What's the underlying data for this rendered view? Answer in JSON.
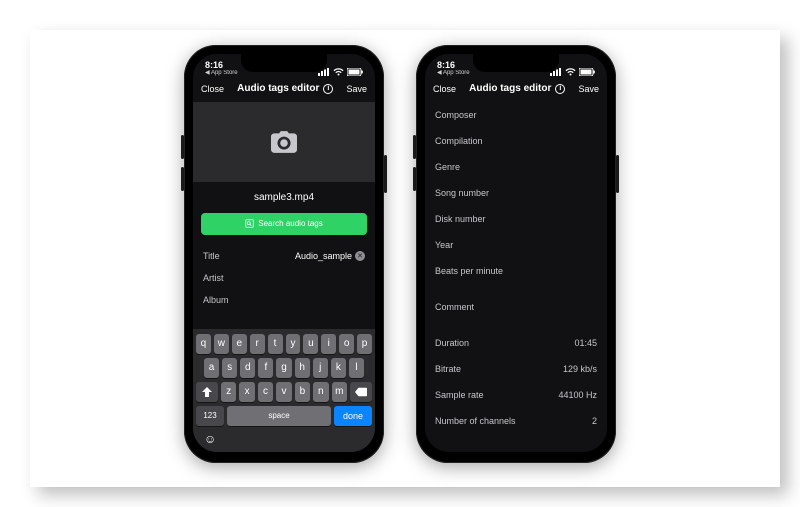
{
  "status": {
    "time": "8:16",
    "back": "◀ App Store"
  },
  "nav": {
    "close": "Close",
    "title": "Audio tags editor",
    "save": "Save"
  },
  "phone1": {
    "filename": "sample3.mp4",
    "search_btn": "Search audio tags",
    "fields": {
      "title_label": "Title",
      "title_value": "Audio_sample",
      "artist_label": "Artist",
      "album_label": "Album"
    },
    "keyboard": {
      "row1": [
        "q",
        "w",
        "e",
        "r",
        "t",
        "y",
        "u",
        "i",
        "o",
        "p"
      ],
      "row2": [
        "a",
        "s",
        "d",
        "f",
        "g",
        "h",
        "j",
        "k",
        "l"
      ],
      "row3": [
        "z",
        "x",
        "c",
        "v",
        "b",
        "n",
        "m"
      ],
      "num": "123",
      "space": "space",
      "done": "done"
    }
  },
  "phone2": {
    "fields": [
      {
        "label": "Composer",
        "value": ""
      },
      {
        "label": "Compilation",
        "value": ""
      },
      {
        "label": "Genre",
        "value": ""
      },
      {
        "label": "Song number",
        "value": ""
      },
      {
        "label": "Disk number",
        "value": ""
      },
      {
        "label": "Year",
        "value": ""
      },
      {
        "label": "Beats per minute",
        "value": ""
      }
    ],
    "comment_label": "Comment",
    "readonly": [
      {
        "label": "Duration",
        "value": "01:45"
      },
      {
        "label": "Bitrate",
        "value": "129 kb/s"
      },
      {
        "label": "Sample rate",
        "value": "44100 Hz"
      },
      {
        "label": "Number of channels",
        "value": "2"
      }
    ]
  }
}
